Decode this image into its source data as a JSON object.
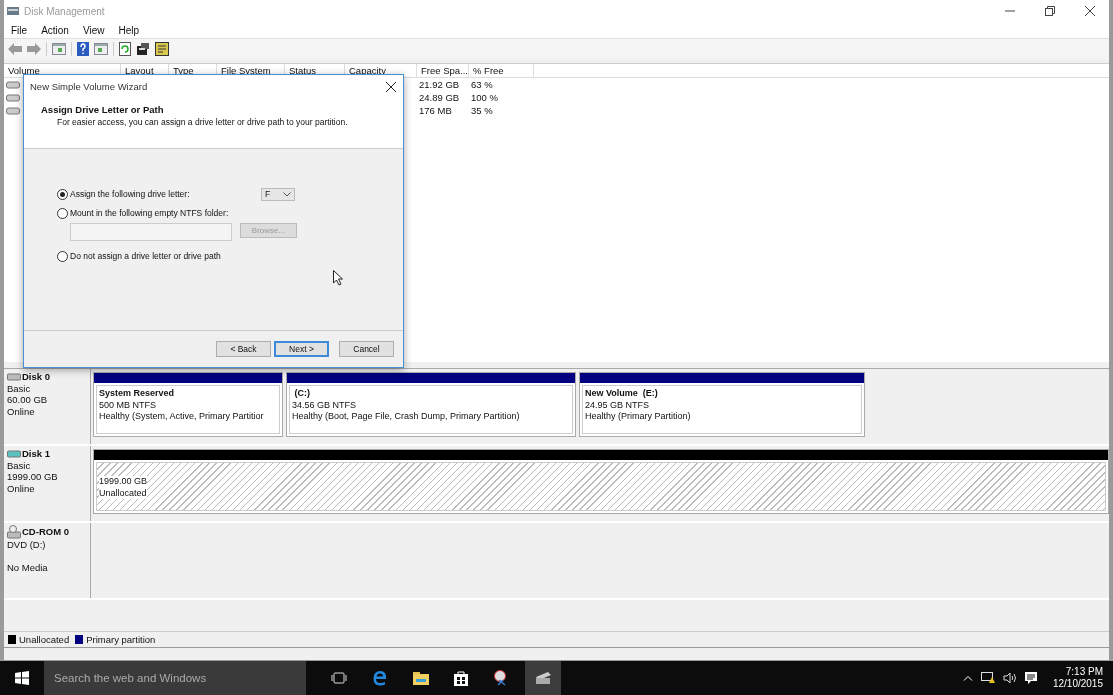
{
  "window": {
    "title": "Disk Management"
  },
  "menu": [
    "File",
    "Action",
    "View",
    "Help"
  ],
  "volume_list": {
    "columns": [
      "Volume",
      "Layout",
      "Type",
      "File System",
      "Status",
      "Capacity",
      "Free Spa...",
      "% Free"
    ],
    "rows": [
      {
        "free_space": "21.92 GB",
        "percent_free": "63 %"
      },
      {
        "free_space": "24.89 GB",
        "percent_free": "100 %"
      },
      {
        "free_space": "176 MB",
        "percent_free": "35 %"
      }
    ]
  },
  "disks": [
    {
      "kind": "disk",
      "name": "Disk 0",
      "lines": [
        "Basic",
        "60.00 GB",
        "Online"
      ],
      "partitions": [
        {
          "color": "#000080",
          "hatched": false,
          "title": "System Reserved",
          "size": "500 MB NTFS",
          "status": "Healthy (System, Active, Primary Partitior"
        },
        {
          "color": "#000080",
          "hatched": false,
          "title": " (C:)",
          "size": "34.56 GB NTFS",
          "status": "Healthy (Boot, Page File, Crash Dump, Primary Partition)"
        },
        {
          "color": "#000080",
          "hatched": false,
          "title": "New Volume  (E:)",
          "size": "24.95 GB NTFS",
          "status": "Healthy (Primary Partition)"
        }
      ]
    },
    {
      "kind": "disk",
      "name": "Disk 1",
      "lines": [
        "Basic",
        "1999.00 GB",
        "Online"
      ],
      "partitions": [
        {
          "color": "#000000",
          "hatched": true,
          "size": "1999.00 GB",
          "status": "Unallocated"
        }
      ]
    },
    {
      "kind": "cdrom",
      "name": "CD-ROM 0",
      "lines": [
        "DVD (D:)"
      ],
      "media": "No Media"
    }
  ],
  "legend": [
    {
      "label": "Unallocated",
      "color": "#000000"
    },
    {
      "label": "Primary partition",
      "color": "#000080"
    }
  ],
  "dialog": {
    "title": "New Simple Volume Wizard",
    "heading": "Assign Drive Letter or Path",
    "subtitle": "For easier access, you can assign a drive letter or drive path to your partition.",
    "options": [
      {
        "kind": "letter",
        "label": "Assign the following drive letter:",
        "selected": true
      },
      {
        "kind": "folder",
        "label": "Mount in the following empty NTFS folder:",
        "selected": false
      },
      {
        "kind": "none",
        "label": "Do not assign a drive letter or drive path",
        "selected": false
      }
    ],
    "drive_letter": "F",
    "browse_button": {
      "label": "Browse...",
      "disabled": true
    },
    "buttons": [
      {
        "label": "< Back",
        "default": false
      },
      {
        "label": "Next >",
        "default": true
      },
      {
        "label": "Cancel",
        "default": false
      }
    ]
  },
  "taskbar": {
    "search_placeholder": "Search the web and Windows",
    "time": "7:13 PM",
    "date": "12/10/2015"
  }
}
